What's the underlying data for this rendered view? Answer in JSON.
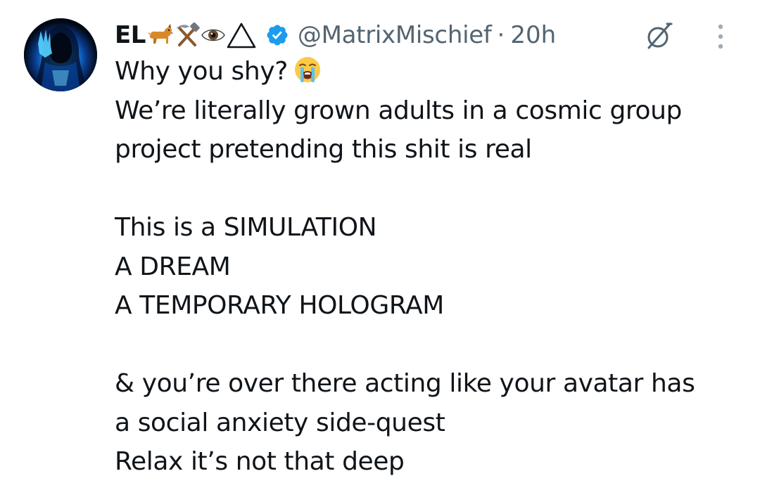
{
  "tweet": {
    "display_name": "EL",
    "name_emojis": [
      "dog-emoji",
      "hammer-and-pick-emoji",
      "eye-in-triangle-emoji"
    ],
    "handle": "@MatrixMischief",
    "separator": "·",
    "time": "20h",
    "verified_icon": "verified-badge-icon",
    "grok_icon": "grok-icon",
    "more_icon": "more-options-icon",
    "text": {
      "line1": "Why you shy?",
      "line1_emoji": "loudly-crying-face-emoji",
      "line2": "We’re literally grown adults in a cosmic group",
      "line3": "project pretending this shit is real",
      "line4": "This is a SIMULATION",
      "line5": "A DREAM",
      "line6": "A TEMPORARY HOLOGRAM",
      "line7": "& you’re over there acting like your avatar has",
      "line8": "a social anxiety side-quest",
      "line9": "Relax it’s not that deep"
    }
  },
  "colors": {
    "text_primary": "#0f1419",
    "text_secondary": "#536471",
    "verified_blue": "#1d9bf0",
    "background": "#ffffff"
  }
}
